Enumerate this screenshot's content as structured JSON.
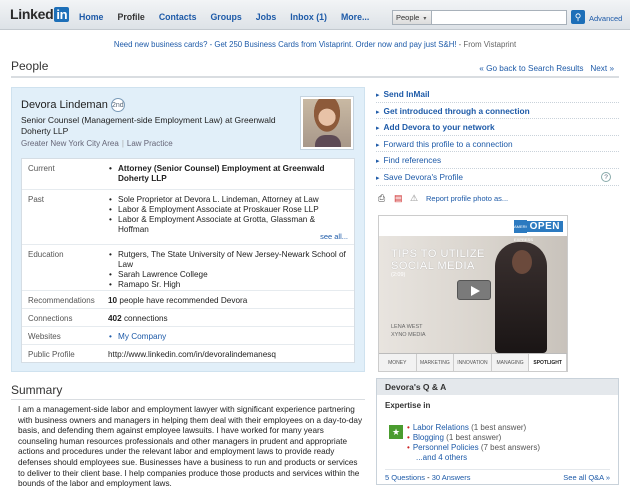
{
  "header": {
    "logo_text": "Linked",
    "logo_in": "in",
    "nav": [
      "Home",
      "Profile",
      "Contacts",
      "Groups",
      "Jobs",
      "Inbox (1)",
      "More..."
    ],
    "search_scope": "People",
    "search_placeholder": "",
    "advanced": "Advanced"
  },
  "ad_banner": {
    "text": "Need new business cards? - Get 250 Business Cards from Vistaprint. Order now and pay just S&H!",
    "source": " - From Vistaprint"
  },
  "page": {
    "title": "People",
    "back_link": "« Go back to Search Results",
    "next_link": "Next »"
  },
  "profile": {
    "name": "Devora Lindeman",
    "degree": "2nd",
    "headline": "Senior Counsel (Management-side Employment Law) at Greenwald Doherty LLP",
    "location": "Greater New York City Area",
    "industry": "Law Practice",
    "current_label": "Current",
    "current": "Attorney (Senior Counsel) Employment at Greenwald Doherty LLP",
    "past_label": "Past",
    "past": [
      "Sole Proprietor at Devora L. Lindeman, Attorney at Law",
      "Labor & Employment Associate at Proskauer Rose LLP",
      "Labor & Employment Associate at Grotta, Glassman & Hoffman"
    ],
    "see_all": "see all...",
    "education_label": "Education",
    "education": [
      "Rutgers, The State University of New Jersey-Newark School of Law",
      "Sarah Lawrence College",
      "Ramapo Sr. High"
    ],
    "recommendations_label": "Recommendations",
    "recommendations_count": "10",
    "recommendations_text": " people have recommended Devora",
    "connections_label": "Connections",
    "connections_count": "402",
    "connections_text": " connections",
    "websites_label": "Websites",
    "website": "My Company",
    "public_profile_label": "Public Profile",
    "public_profile": "http://www.linkedin.com/in/devoralindemanesq"
  },
  "summary": {
    "title": "Summary",
    "text": "I am a management-side labor and employment lawyer with significant experience partnering with business owners and managers in helping them deal with their employees on a day-to-day basis, and defending them against employee lawsuits. I have worked for many years counseling human resources professionals and other managers in prudent and appropriate actions and procedures under the relevant labor and employment laws to provide ready defenses should employees sue. Businesses have a business to run and products or services to deliver to their client base. I help companies produce those products and services within the bounds of the labor and employment laws."
  },
  "actions": [
    {
      "label": "Send InMail",
      "bold": true
    },
    {
      "label": "Get introduced through a connection",
      "bold": true
    },
    {
      "label": "Add Devora to your network",
      "bold": true
    },
    {
      "label": "Forward this profile to a connection",
      "bold": false
    },
    {
      "label": "Find references",
      "bold": false
    },
    {
      "label": "Save Devora's Profile",
      "bold": false
    }
  ],
  "help_icon": "?",
  "report_photo": "Report profile photo as...",
  "side_ad": {
    "brand": "OPEN",
    "amex": "AMERICAN EXPRESS",
    "title_line1": "TIPS TO UTILIZE",
    "title_line2": "SOCIAL MEDIA",
    "duration": "(2:09)",
    "speaker": "LENA WEST",
    "company": "XYNO MEDIA",
    "tabs": [
      "MONEY",
      "MARKETING",
      "INNOVATION",
      "MANAGING",
      "SPOTLIGHT"
    ]
  },
  "qa": {
    "title": "Devora's Q & A",
    "expertise_label": "Expertise in",
    "items": [
      {
        "topic": "Labor Relations",
        "answers": " (1 best answer)"
      },
      {
        "topic": "Blogging",
        "answers": " (1 best answer)"
      },
      {
        "topic": "Personnel Policies",
        "answers": " (7 best answers)"
      }
    ],
    "more": "...and 4 others",
    "questions": "5 Questions",
    "sep": " - ",
    "answers": "30 Answers",
    "see_all": "See all Q&A »"
  }
}
